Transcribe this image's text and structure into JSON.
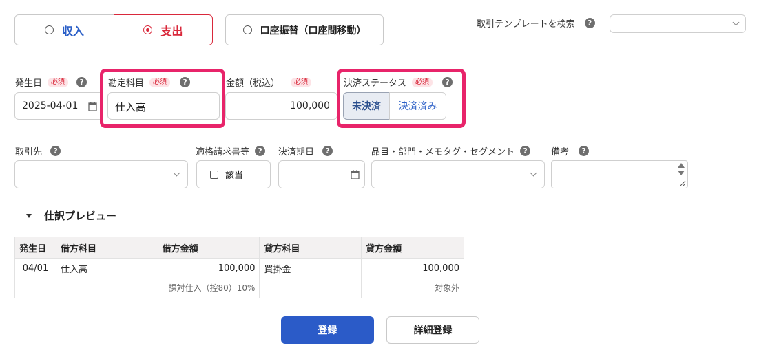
{
  "type_toggle": {
    "income": "収入",
    "expense": "支出",
    "transfer": "口座振替（口座間移動）"
  },
  "template_search": {
    "label": "取引テンプレートを検索",
    "value": ""
  },
  "fields": {
    "date": {
      "label": "発生日",
      "required": "必須",
      "value": "2025-04-01"
    },
    "account": {
      "label": "勘定科目",
      "required": "必須",
      "value": "仕入高"
    },
    "amount": {
      "label": "金額（税込）",
      "required": "必須",
      "value": "100,000"
    },
    "status": {
      "label": "決済ステータス",
      "required": "必須",
      "unpaid": "未決済",
      "paid": "決済済み"
    },
    "partner": {
      "label": "取引先",
      "value": ""
    },
    "invoice": {
      "label": "適格請求書等",
      "checkbox_label": "該当"
    },
    "due_date": {
      "label": "決済期日",
      "value": ""
    },
    "item": {
      "label": "品目・部門・メモタグ・セグメント",
      "value": ""
    },
    "memo": {
      "label": "備考",
      "value": ""
    }
  },
  "help_glyph": "?",
  "preview": {
    "title": "仕訳プレビュー",
    "headers": [
      "発生日",
      "借方科目",
      "借方金額",
      "貸方科目",
      "貸方金額"
    ],
    "row": {
      "date": "04/01",
      "debit_account": "仕入高",
      "debit_amount": "100,000",
      "credit_account": "買掛金",
      "credit_amount": "100,000"
    },
    "subrow": {
      "debit_tax": "課対仕入（控80）10%",
      "credit_tax": "対象外"
    }
  },
  "buttons": {
    "register": "登録",
    "detail_register": "詳細登録"
  },
  "colors": {
    "highlight": "#e8246a",
    "expense_accent": "#d9283b",
    "income_accent": "#2b5fc7",
    "primary_button": "#2b5bc8"
  }
}
